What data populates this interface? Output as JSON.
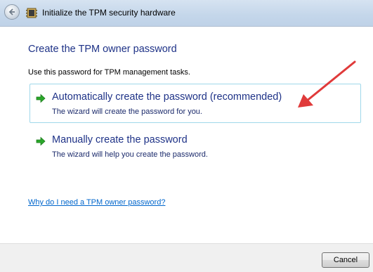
{
  "window": {
    "title": "Initialize the TPM security hardware"
  },
  "page": {
    "heading": "Create the TPM owner password",
    "description": "Use this password for TPM management tasks."
  },
  "options": [
    {
      "title": "Automatically create the password (recommended)",
      "subtitle": "The wizard will create the password for you.",
      "icon": "green-arrow-icon"
    },
    {
      "title": "Manually create the password",
      "subtitle": "The wizard will help you create the password.",
      "icon": "green-arrow-icon"
    }
  ],
  "help_link": "Why do I need a TPM owner password?",
  "footer": {
    "cancel_label": "Cancel"
  },
  "colors": {
    "heading": "#1e3287",
    "link": "#0066cc",
    "option_hover_border": "#9fd8ea",
    "annotation_arrow": "#e03a3a",
    "option_arrow": "#2aa82a"
  }
}
